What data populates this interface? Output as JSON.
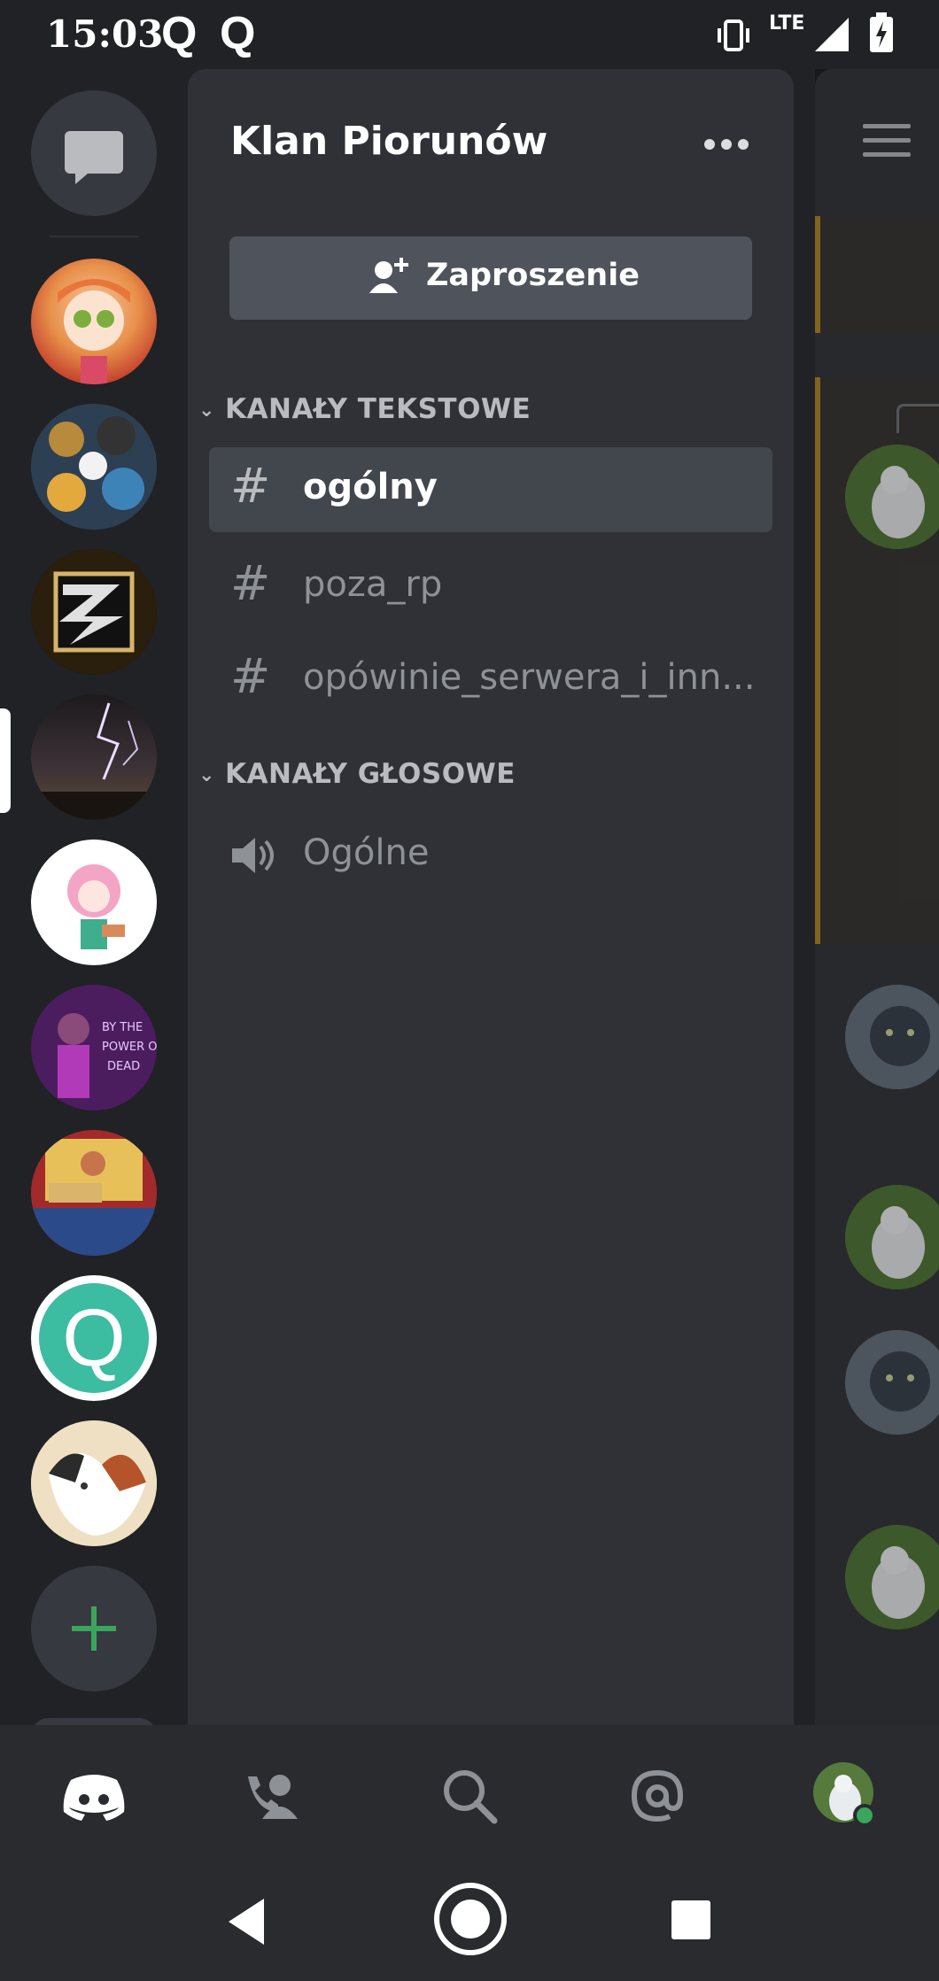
{
  "status_bar": {
    "time": "15:03",
    "notif_q1": "Q",
    "notif_q2": "Q",
    "network": "LTE"
  },
  "server": {
    "name": "Klan Piorunów"
  },
  "invite_button": {
    "label": "Zaproszenie"
  },
  "categories": {
    "text": {
      "label": "KANAŁY TEKSTOWE"
    },
    "voice": {
      "label": "KANAŁY GŁOSOWE"
    }
  },
  "text_channels": [
    {
      "name": "ogólny",
      "active": true
    },
    {
      "name": "poza_rp",
      "active": false
    },
    {
      "name": "opówinie_serwera_i_inn...",
      "active": false
    }
  ],
  "voice_channels": [
    {
      "name": "Ogólne"
    }
  ],
  "server_icon_q": "Q",
  "colors": {
    "accent_green": "#3ba55d",
    "brand_blurple": "#ffffff",
    "online": "#3ba55d"
  }
}
